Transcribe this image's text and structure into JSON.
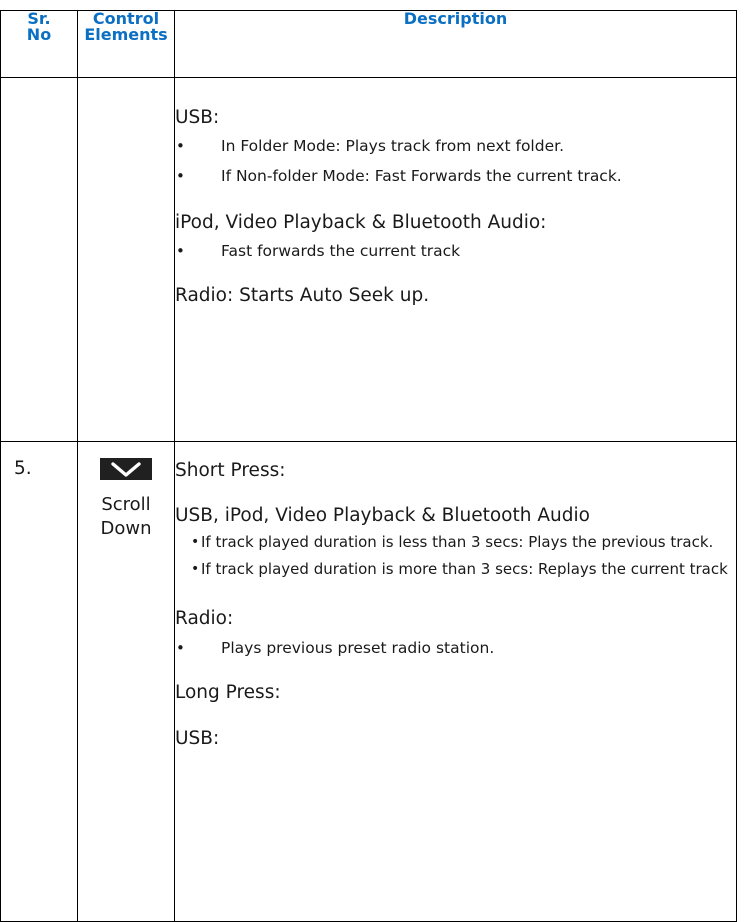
{
  "header": {
    "sr_line1": "Sr.",
    "sr_line2": "No",
    "ctrl_line1": "Control",
    "ctrl_line2": "Elements",
    "desc": "Description"
  },
  "row1": {
    "usb_title": "USB:",
    "usb_items": [
      "In Folder Mode: Plays track from next folder.",
      "If Non-folder Mode: Fast Forwards the current track."
    ],
    "ipod_title": "iPod, Video Playback & Bluetooth Audio:",
    "ipod_items": [
      "Fast forwards the current track"
    ],
    "radio_text": "Radio: Starts Auto Seek up."
  },
  "row2": {
    "number": "5.",
    "control_icon": "chevron-down-icon",
    "control_label_line1": "Scroll",
    "control_label_line2": "Down",
    "short_press": "Short Press:",
    "usb_title": "USB, iPod, Video Playback & Bluetooth Audio",
    "usb_items": [
      "If track played duration is less than 3 secs: Plays the previous track.",
      "If track played duration is more than 3 secs: Replays the current track"
    ],
    "radio_title": "Radio:",
    "radio_items": [
      "Plays previous preset radio station."
    ],
    "long_press": "Long Press:",
    "long_usb": "USB:"
  },
  "colors": {
    "header_text": "#0b6fc4",
    "icon_bg": "#202020"
  }
}
